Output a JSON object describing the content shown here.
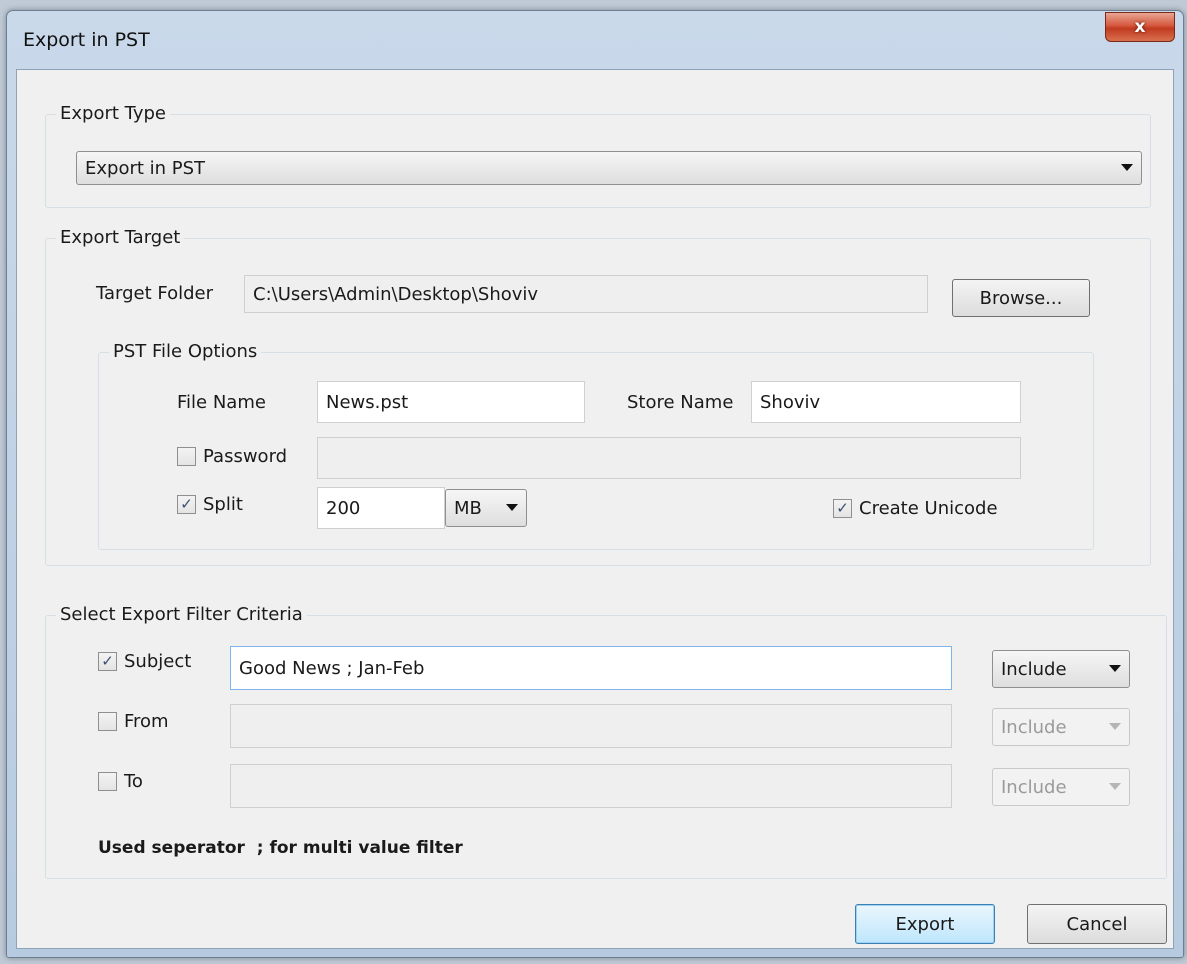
{
  "window": {
    "title": "Export in PST",
    "close_glyph": "x"
  },
  "export_type": {
    "group_label": "Export Type",
    "selected": "Export in PST"
  },
  "export_target": {
    "group_label": "Export Target",
    "target_folder_label": "Target Folder",
    "target_folder_value": "C:\\Users\\Admin\\Desktop\\Shoviv",
    "browse_label": "Browse..."
  },
  "pst_options": {
    "group_label": "PST File Options",
    "file_name_label": "File Name",
    "file_name_value": "News.pst",
    "store_name_label": "Store Name",
    "store_name_value": "Shoviv",
    "password_label": "Password",
    "password_checked": false,
    "split_label": "Split",
    "split_checked": true,
    "split_value": "200",
    "split_unit": "MB",
    "unicode_label": "Create Unicode",
    "unicode_checked": true
  },
  "filter": {
    "group_label": "Select Export Filter Criteria",
    "rows": [
      {
        "label": "Subject",
        "checked": true,
        "value": "Good News ; Jan-Feb",
        "mode": "Include",
        "enabled": true
      },
      {
        "label": "From",
        "checked": false,
        "value": "",
        "mode": "Include",
        "enabled": false
      },
      {
        "label": "To",
        "checked": false,
        "value": "",
        "mode": "Include",
        "enabled": false
      }
    ],
    "separator_note": "Used seperator  ; for multi value filter"
  },
  "footer": {
    "export_label": "Export",
    "cancel_label": "Cancel"
  },
  "check_glyph": "✓"
}
